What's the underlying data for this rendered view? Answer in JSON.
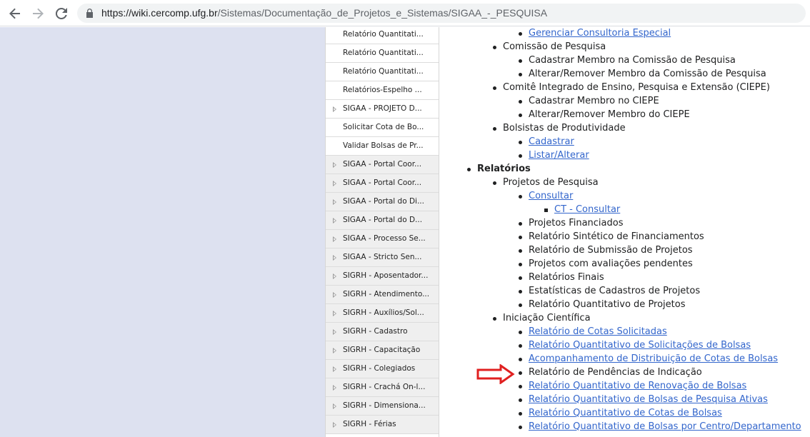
{
  "browser": {
    "url_host": "https://wiki.cercomp.ufg.br",
    "url_path": "/Sistemas/Documentação_de_Projetos_e_Sistemas/SIGAA_-_PESQUISA"
  },
  "sidebar": {
    "items": [
      {
        "label": "Relatório Quantitati...",
        "type": "leaf"
      },
      {
        "label": "Relatório Quantitati...",
        "type": "leaf"
      },
      {
        "label": "Relatório Quantitati...",
        "type": "leaf"
      },
      {
        "label": "Relatórios-Espelho ...",
        "type": "leaf"
      },
      {
        "label": "SIGAA - PROJETO D...",
        "type": "branch-white"
      },
      {
        "label": "Solicitar Cota de Bo...",
        "type": "leaf"
      },
      {
        "label": "Validar Bolsas de Pr...",
        "type": "leaf"
      },
      {
        "label": "SIGAA - Portal Coor...",
        "type": "branch"
      },
      {
        "label": "SIGAA - Portal Coor...",
        "type": "branch"
      },
      {
        "label": "SIGAA - Portal do Di...",
        "type": "branch"
      },
      {
        "label": "SIGAA - Portal do D...",
        "type": "branch"
      },
      {
        "label": "SIGAA - Processo Se...",
        "type": "branch"
      },
      {
        "label": "SIGAA - Stricto Sen...",
        "type": "branch"
      },
      {
        "label": "SIGRH - Aposentador...",
        "type": "branch"
      },
      {
        "label": "SIGRH - Atendimento...",
        "type": "branch"
      },
      {
        "label": "SIGRH - Auxílios/Sol...",
        "type": "branch"
      },
      {
        "label": "SIGRH - Cadastro",
        "type": "branch"
      },
      {
        "label": "SIGRH - Capacitação",
        "type": "branch"
      },
      {
        "label": "SIGRH - Colegiados",
        "type": "branch"
      },
      {
        "label": "SIGRH - Crachá On-l...",
        "type": "branch"
      },
      {
        "label": "SIGRH - Dimensiona...",
        "type": "branch"
      },
      {
        "label": "SIGRH - Férias",
        "type": "branch"
      }
    ]
  },
  "content": {
    "rows": [
      {
        "text": "Gerenciar Consultoria Especial",
        "level": 2,
        "link": true
      },
      {
        "text": "Comissão de Pesquisa",
        "level": 1,
        "link": false
      },
      {
        "text": "Cadastrar Membro na Comissão de Pesquisa",
        "level": 2,
        "link": false
      },
      {
        "text": "Alterar/Remover Membro da Comissão de Pesquisa",
        "level": 2,
        "link": false
      },
      {
        "text": "Comitê Integrado de Ensino, Pesquisa e Extensão (CIEPE)",
        "level": 1,
        "link": false
      },
      {
        "text": "Cadastrar Membro no CIEPE",
        "level": 2,
        "link": false
      },
      {
        "text": "Alterar/Remover Membro do CIEPE",
        "level": 2,
        "link": false
      },
      {
        "text": "Bolsistas de Produtividade",
        "level": 1,
        "link": false
      },
      {
        "text": "Cadastrar",
        "level": 2,
        "link": true
      },
      {
        "text": "Listar/Alterar",
        "level": 2,
        "link": true
      },
      {
        "text": "Relatórios",
        "level": 0,
        "link": false,
        "bold": true
      },
      {
        "text": "Projetos de Pesquisa",
        "level": 1,
        "link": false
      },
      {
        "text": "Consultar",
        "level": 2,
        "link": true
      },
      {
        "text": "CT - Consultar",
        "level": 3,
        "link": true
      },
      {
        "text": "Projetos Financiados",
        "level": 2,
        "link": false
      },
      {
        "text": "Relatório Sintético de Financiamentos",
        "level": 2,
        "link": false
      },
      {
        "text": "Relatório de Submissão de Projetos",
        "level": 2,
        "link": false
      },
      {
        "text": "Projetos com avaliações pendentes",
        "level": 2,
        "link": false
      },
      {
        "text": "Relatórios Finais",
        "level": 2,
        "link": false
      },
      {
        "text": "Estatísticas de Cadastros de Projetos",
        "level": 2,
        "link": false
      },
      {
        "text": "Relatório Quantitativo de Projetos",
        "level": 2,
        "link": false
      },
      {
        "text": "Iniciação Científica",
        "level": 1,
        "link": false
      },
      {
        "text": "Relatório de Cotas Solicitadas",
        "level": 2,
        "link": true
      },
      {
        "text": "Relatório Quantitativo de Solicitações de Bolsas",
        "level": 2,
        "link": true
      },
      {
        "text": "Acompanhamento de Distribuição de Cotas de Bolsas",
        "level": 2,
        "link": true
      },
      {
        "text": "Relatório de Pendências de Indicação",
        "level": 2,
        "link": false
      },
      {
        "text": "Relatório Quantitativo de Renovação de Bolsas",
        "level": 2,
        "link": true
      },
      {
        "text": "Relatório Quantitativo de Bolsas de Pesquisa Ativas",
        "level": 2,
        "link": true
      },
      {
        "text": "Relatório Quantitativo de Cotas de Bolsas",
        "level": 2,
        "link": true
      },
      {
        "text": "Relatório Quantitativo de Bolsas por Centro/Departamento",
        "level": 2,
        "link": true
      }
    ]
  },
  "colors": {
    "link": "#3366cc",
    "arrow": "#e02020",
    "left_pane": "#dde1f0"
  },
  "icons": [
    "back-arrow-icon",
    "forward-arrow-icon",
    "reload-icon",
    "lock-icon",
    "tree-expand-icon",
    "red-arrow-icon"
  ]
}
